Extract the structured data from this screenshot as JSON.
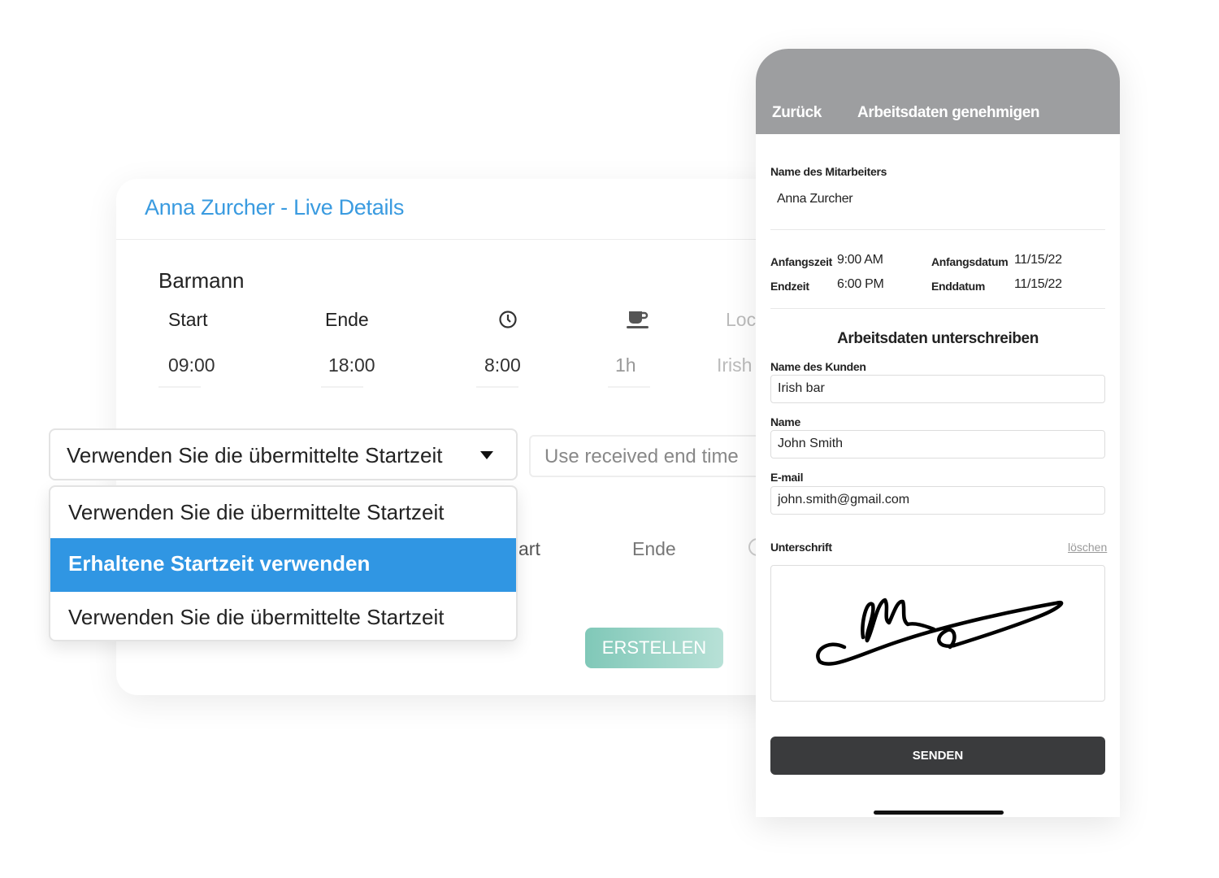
{
  "live": {
    "title": "Anna Zurcher - Live Details",
    "role": "Barmann",
    "headers": {
      "start": "Start",
      "end": "Ende",
      "duration_icon": "clock-icon",
      "break_icon": "coffee-cup-icon",
      "location": "Loc"
    },
    "values": {
      "start": "09:00",
      "end": "18:00",
      "duration": "8:00",
      "break": "1h",
      "location": "Irish"
    },
    "second_headers": {
      "start": "art",
      "end": "Ende"
    },
    "create_button": "ERSTELLEN"
  },
  "start_select": {
    "value": "Verwenden Sie die übermittelte Startzeit",
    "options": [
      "Verwenden Sie die übermittelte Startzeit",
      "Erhaltene Startzeit verwenden",
      "Verwenden Sie die übermittelte Startzeit"
    ],
    "highlighted_index": 1
  },
  "end_select": {
    "value": "Use received end time"
  },
  "phone": {
    "back": "Zurück",
    "title": "Arbeitsdaten genehmigen",
    "employee_label": "Name des Mitarbeiters",
    "employee": "Anna Zurcher",
    "start_time_label": "Anfangszeit",
    "start_time": "9:00 AM",
    "end_time_label": "Endzeit",
    "end_time": "6:00 PM",
    "start_date_label": "Anfangsdatum",
    "start_date": "11/15/22",
    "end_date_label": "Enddatum",
    "end_date": "11/15/22",
    "sign_heading": "Arbeitsdaten unterschreiben",
    "customer_label": "Name des Kunden",
    "customer": "Irish bar",
    "name_label": "Name",
    "name": "John Smith",
    "email_label": "E-mail",
    "email": "john.smith@gmail.com",
    "signature_label": "Unterschrift",
    "clear": "löschen",
    "send": "SENDEN"
  },
  "colors": {
    "accent": "#3a9be0",
    "highlight": "#3096e3",
    "header_gray": "#9d9ea0",
    "send_button": "#3a3b3d",
    "create_button": "#80c8b8"
  }
}
